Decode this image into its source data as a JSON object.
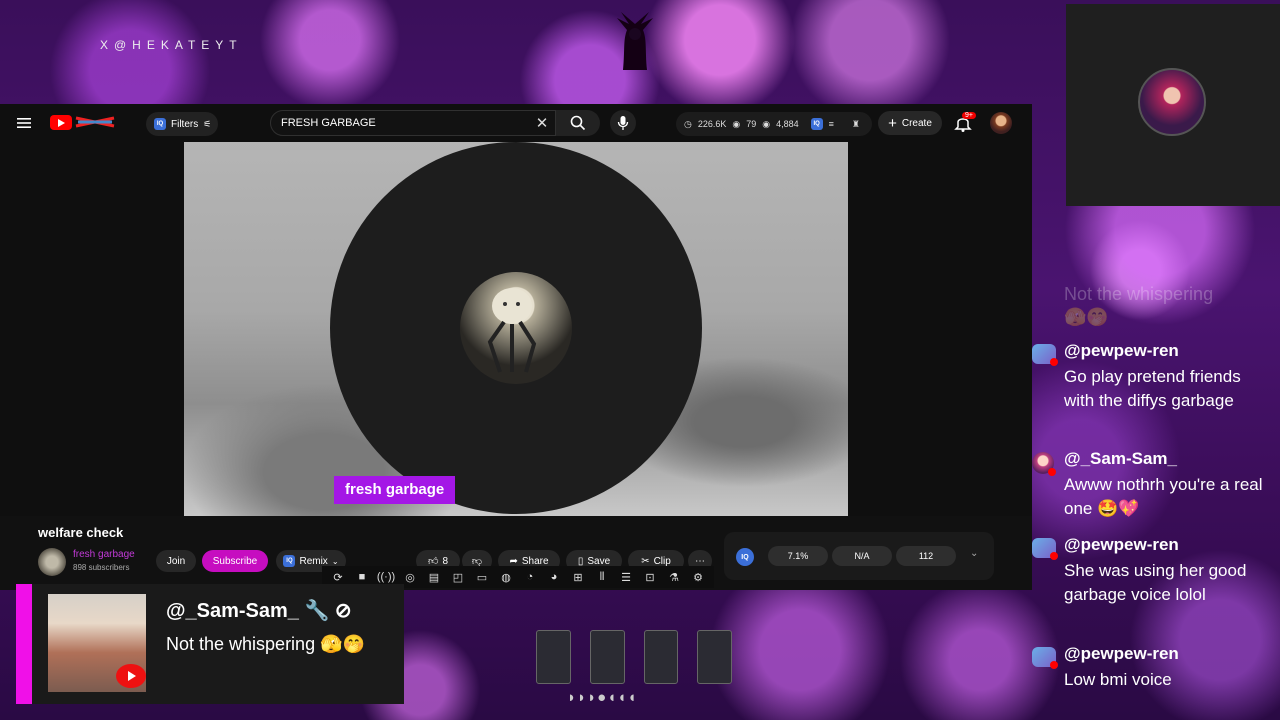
{
  "brand": "X@HEKATEYT",
  "youtube": {
    "filters_label": "Filters",
    "search_value": "FRESH GARBAGE",
    "stats": {
      "views": "226.6K",
      "watching": "79",
      "count": "4,884"
    },
    "create_label": "Create",
    "notif_badge": "9+",
    "caption": "fresh garbage",
    "video_title": "welfare check",
    "channel_name": "fresh garbage",
    "subscribers": "898 subscribers",
    "join_label": "Join",
    "subscribe_label": "Subscribe",
    "remix_label": "Remix",
    "likes": "8",
    "share_label": "Share",
    "save_label": "Save",
    "clip_label": "Clip",
    "iq_metrics": [
      "7.1%",
      "N/A",
      "112"
    ]
  },
  "chat": {
    "faded_text": "Not the whispering",
    "messages": [
      {
        "name": "@pewpew-ren",
        "text": "Go play pretend friends with the diffys garbage"
      },
      {
        "name": "@_Sam-Sam_",
        "text": "Awww nothrh you're a real one 🤩💖"
      },
      {
        "name": "@pewpew-ren",
        "text": "She was using her good garbage voice lolol"
      },
      {
        "name": "@pewpew-ren",
        "text": "Low bmi voice"
      }
    ]
  },
  "highlight": {
    "name": "@_Sam-Sam_ 🔧 ⊘",
    "text": "Not the whispering 🫣🤭"
  },
  "moons": "◗◗◗●◖◖◖"
}
